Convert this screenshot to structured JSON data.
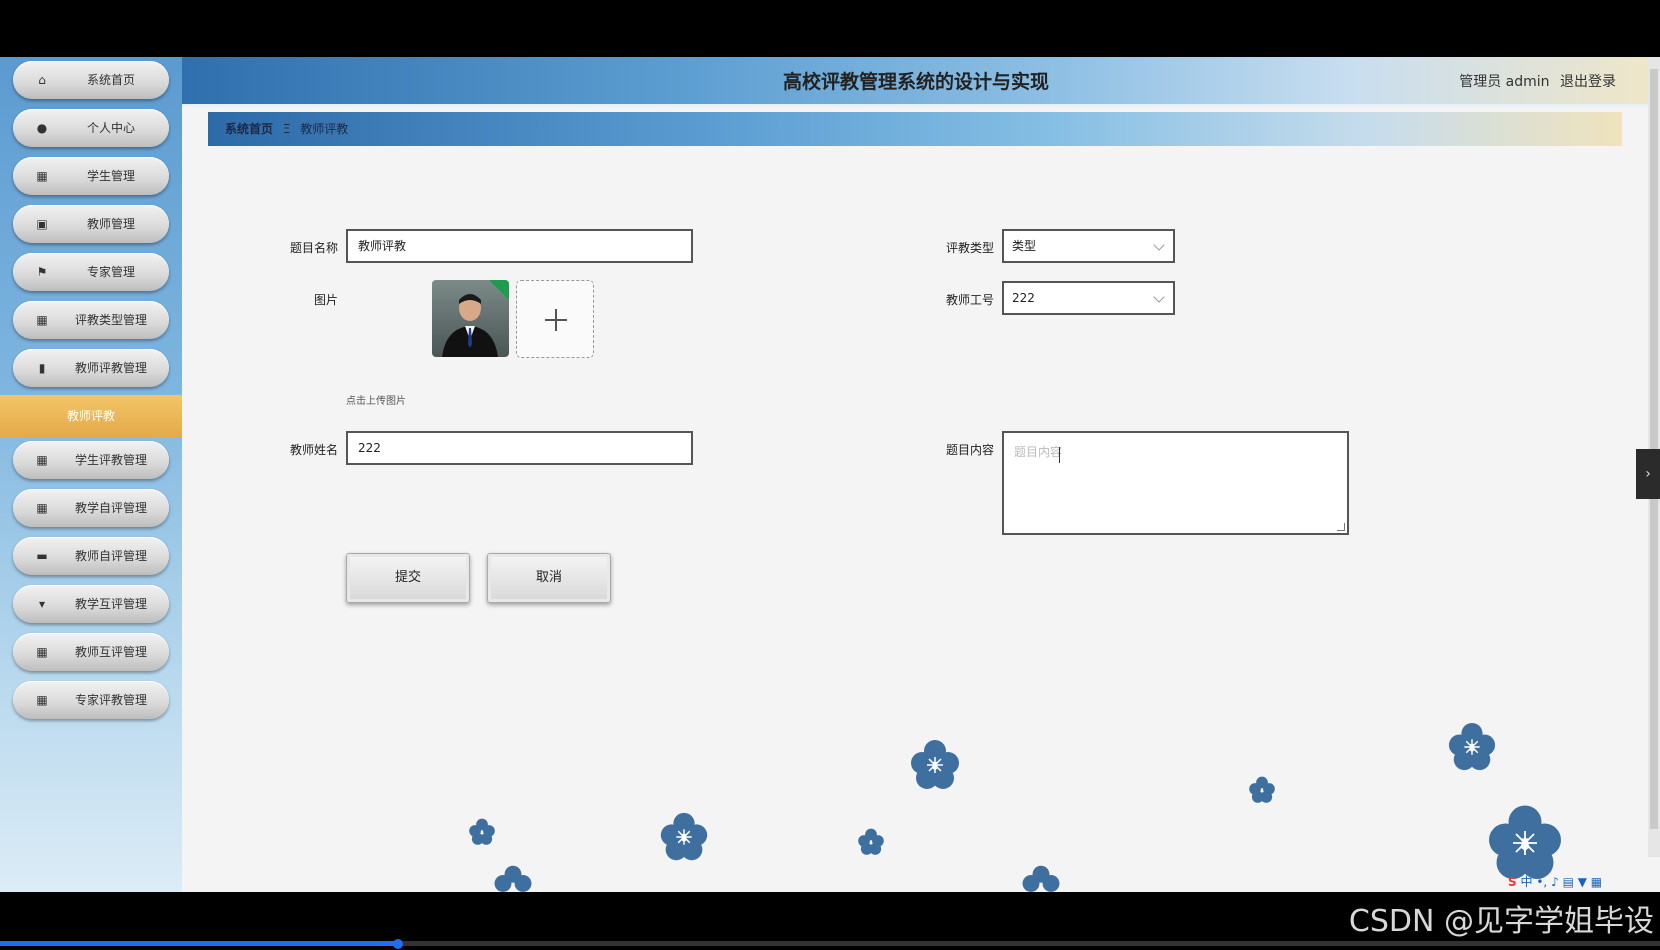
{
  "header": {
    "title": "高校评教管理系统的设计与实现",
    "user_name": "管理员 admin",
    "logout": "退出登录"
  },
  "breadcrumb": {
    "home": "系统首页",
    "separator": "Ξ",
    "current": "教师评教"
  },
  "sidebar": {
    "items": [
      {
        "label": "系统首页",
        "icon": "home-icon"
      },
      {
        "label": "个人中心",
        "icon": "user-icon"
      },
      {
        "label": "学生管理",
        "icon": "grid-icon"
      },
      {
        "label": "教师管理",
        "icon": "clipboard-icon"
      },
      {
        "label": "专家管理",
        "icon": "flag-icon"
      },
      {
        "label": "评教类型管理",
        "icon": "grid-icon"
      },
      {
        "label": "教师评教管理",
        "icon": "bar-chart-icon"
      },
      {
        "label": "学生评教管理",
        "icon": "grid-icon"
      },
      {
        "label": "教学自评管理",
        "icon": "grid-icon"
      },
      {
        "label": "教师自评管理",
        "icon": "briefcase-icon"
      },
      {
        "label": "教学互评管理",
        "icon": "podium-icon"
      },
      {
        "label": "教师互评管理",
        "icon": "grid-icon"
      },
      {
        "label": "专家评教管理",
        "icon": "grid-icon"
      }
    ],
    "active": "教师评教"
  },
  "form": {
    "title_label": "题目名称",
    "title_value": "教师评教",
    "image_label": "图片",
    "upload_hint": "点击上传图片",
    "teacher_name_label": "教师姓名",
    "teacher_name_value": "222",
    "type_label": "评教类型",
    "type_value": "类型",
    "teacher_id_label": "教师工号",
    "teacher_id_value": "222",
    "content_label": "题目内容",
    "content_placeholder": "题目内容",
    "submit": "提交",
    "cancel": "取消"
  },
  "watermark": "CSDN @见字学姐毕设",
  "ime": {
    "logo": "S",
    "mode": "中"
  },
  "colors": {
    "accent": "#e4a94a",
    "header_start": "#2f6fae",
    "header_end": "#efe6c8"
  },
  "video_progress": 0.24
}
